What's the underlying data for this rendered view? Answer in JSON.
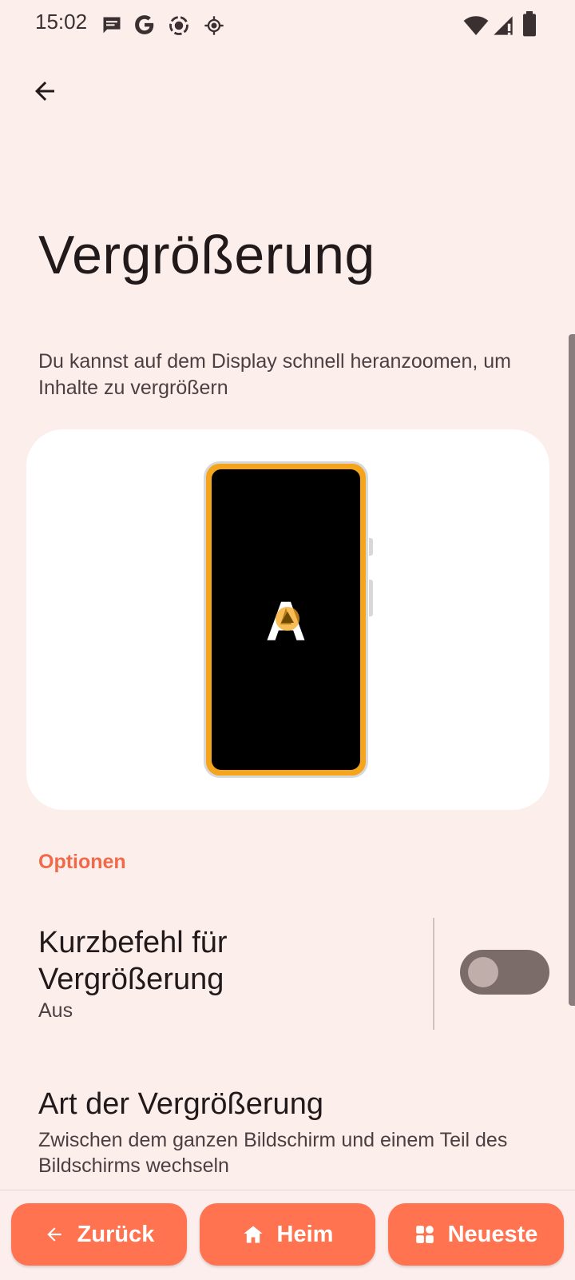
{
  "status_bar": {
    "time": "15:02",
    "icons": [
      "message-icon",
      "google-icon",
      "screen-record-icon",
      "location-icon",
      "wifi-icon",
      "signal-icon",
      "battery-icon"
    ]
  },
  "header": {
    "back_icon": "arrow-back-icon"
  },
  "page": {
    "title": "Vergrößerung",
    "description": "Du kannst auf dem Display schnell heranzoomen, um Inhalte zu vergrößern"
  },
  "illustration": {
    "letter": "A",
    "accent_color": "#F4A51C"
  },
  "options": {
    "section_label": "Optionen",
    "shortcut": {
      "title": "Kurzbefehl für Vergrößerung",
      "summary": "Aus",
      "enabled": false
    },
    "type": {
      "title": "Art der Vergrößerung",
      "summary": "Zwischen dem ganzen Bildschirm und einem Teil des Bildschirms wechseln"
    }
  },
  "nav_bar": {
    "back_label": "Zurück",
    "home_label": "Heim",
    "recents_label": "Neueste",
    "button_color": "#FF7350"
  }
}
